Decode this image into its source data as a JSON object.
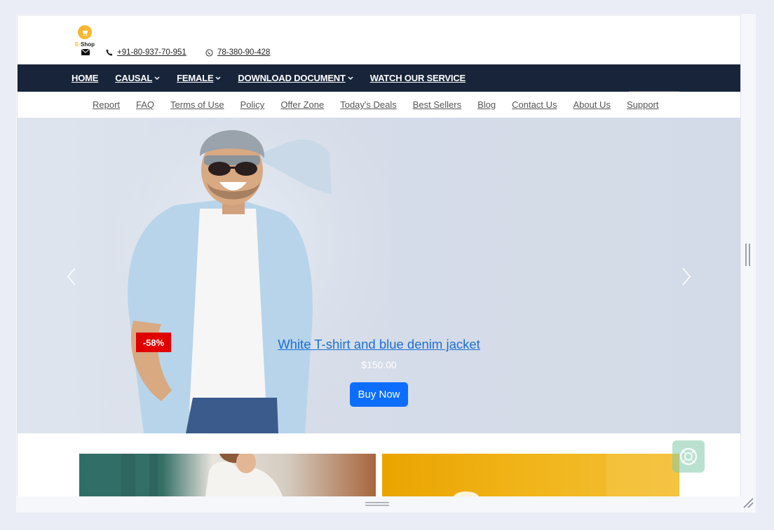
{
  "brand": {
    "logo_text_prefix": "E-",
    "logo_text_suffix": "Shop",
    "accent": "#f7b731"
  },
  "contact": {
    "phone": "+91-80-937-70-951",
    "whatsapp": "78-380-90-428"
  },
  "nav": {
    "items": [
      {
        "label": "HOME",
        "dropdown": false
      },
      {
        "label": "CAUSAL",
        "dropdown": true
      },
      {
        "label": "FEMALE",
        "dropdown": true
      },
      {
        "label": "DOWNLOAD DOCUMENT",
        "dropdown": true
      },
      {
        "label": "WATCH OUR SERVICE",
        "dropdown": false
      }
    ],
    "background": "#17243a"
  },
  "links": [
    "Report",
    "FAQ",
    "Terms of Use",
    "Policy",
    "Offer Zone",
    "Today's Deals",
    "Best Sellers",
    "Blog",
    "Contact Us",
    "About Us",
    "Support"
  ],
  "hero": {
    "discount": "-58%",
    "title": "White T-shirt and blue denim jacket",
    "price": "$150.00",
    "button": "Buy Now",
    "button_color": "#0d6efd",
    "discount_color": "#e00000"
  },
  "icons": [
    "envelope-icon",
    "phone-icon",
    "whatsapp-icon",
    "chevron-down-icon",
    "chevron-left-icon",
    "chevron-right-icon",
    "chat-icon",
    "scroll-handle-icon",
    "resize-grip-icon"
  ]
}
